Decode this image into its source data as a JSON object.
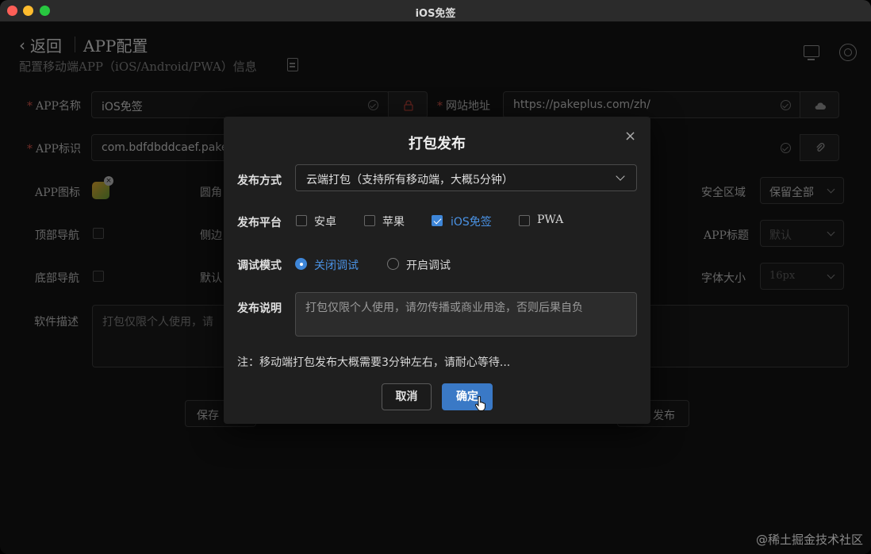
{
  "window": {
    "title": "iOS免签"
  },
  "header": {
    "back_label": "返回",
    "title": "APP配置",
    "subtitle": "配置移动端APP（iOS/Android/PWA）信息"
  },
  "form": {
    "app_name": {
      "label": "APP名称",
      "value": "iOS免签"
    },
    "website": {
      "label": "网站地址",
      "value": "https://pakeplus.com/zh/"
    },
    "app_id": {
      "label": "APP标识",
      "value": "com.bdfdbddcaef.pake"
    },
    "app_icon_label": "APP图标",
    "rounded_label": "圆角",
    "safe_area": {
      "label": "安全区域",
      "value": "保留全部"
    },
    "top_nav_label": "顶部导航",
    "side_label": "侧边",
    "app_title": {
      "label": "APP标题",
      "value": "默认"
    },
    "bottom_nav_label": "底部导航",
    "default_label": "默认",
    "font_size": {
      "label": "字体大小",
      "value": "16px"
    },
    "desc": {
      "label": "软件描述",
      "value": "打包仅限个人使用，请"
    },
    "save_label": "保存",
    "publish_label": "发布"
  },
  "modal": {
    "title": "打包发布",
    "close": "×",
    "method_label": "发布方式",
    "method_value": "云端打包（支持所有移动端，大概5分钟）",
    "platform_label": "发布平台",
    "platforms": [
      {
        "label": "安卓",
        "checked": false
      },
      {
        "label": "苹果",
        "checked": false
      },
      {
        "label": "iOS免签",
        "checked": true
      },
      {
        "label": "PWA",
        "checked": false
      }
    ],
    "debug_label": "调试模式",
    "debug_options": [
      {
        "label": "关闭调试",
        "checked": true
      },
      {
        "label": "开启调试",
        "checked": false
      }
    ],
    "notes_label": "发布说明",
    "notes_placeholder": "打包仅限个人使用，请勿传播或商业用途，否则后果自负",
    "footer_note": "注：移动端打包发布大概需要3分钟左右，请耐心等待...",
    "cancel_label": "取消",
    "ok_label": "确定"
  },
  "watermark": "@稀土掘金技术社区",
  "colors": {
    "accent": "#3a79c6",
    "required": "#e0584c",
    "background": "#151515"
  }
}
